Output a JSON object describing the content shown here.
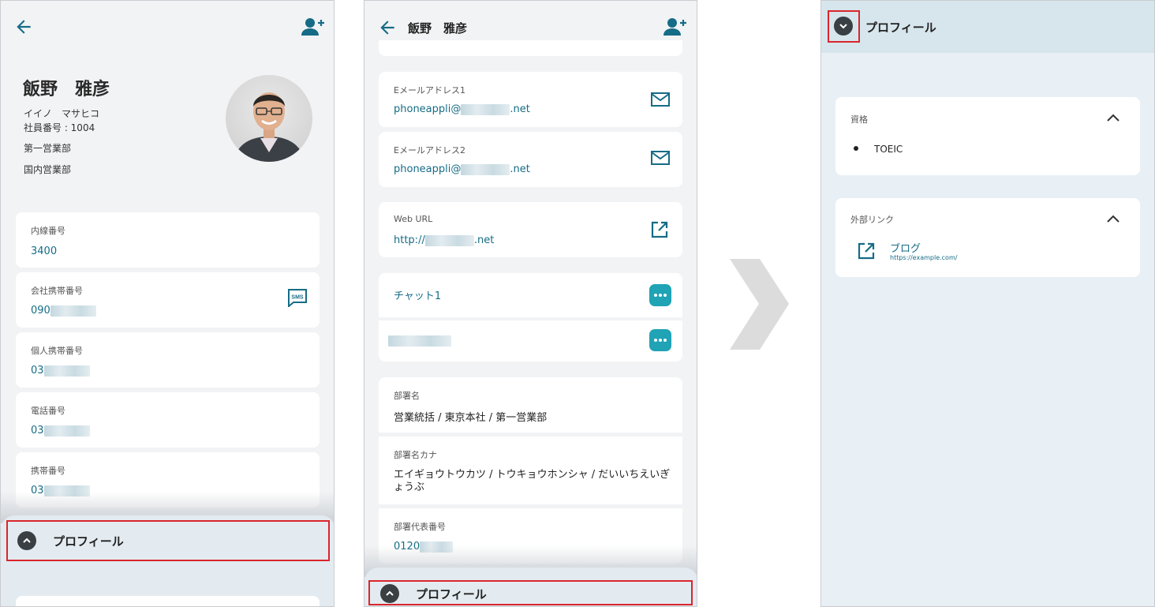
{
  "screen1": {
    "name": "飯野　雅彦",
    "kana": "イイノ　マサヒコ",
    "employee_no": "社員番号 : 1004",
    "dept1": "第一営業部",
    "dept2": "国内営業部",
    "fields": [
      {
        "label": "内線番号",
        "value": "3400"
      },
      {
        "label": "会社携帯番号",
        "value": "090",
        "icon": "sms-icon"
      },
      {
        "label": "個人携帯番号",
        "value": "03"
      },
      {
        "label": "電話番号",
        "value": "03"
      },
      {
        "label": "携帯番号",
        "value": "03"
      }
    ],
    "profile_label": "プロフィール"
  },
  "screen2": {
    "header_name": "飯野　雅彦",
    "email1": {
      "label": "Eメールアドレス1",
      "prefix": "phoneappli@",
      "suffix": ".net"
    },
    "email2": {
      "label": "Eメールアドレス2",
      "prefix": "phoneappli@",
      "suffix": ".net"
    },
    "web": {
      "label": "Web URL",
      "prefix": "http://",
      "suffix": ".net"
    },
    "chat1": {
      "label": "チャット1"
    },
    "dept_name": {
      "label": "部署名",
      "value": "営業統括 / 東京本社 / 第一営業部"
    },
    "dept_kana": {
      "label": "部署名カナ",
      "value": "エイギョウトウカツ / トウキョウホンシャ / だいいちえいぎ\nょうぶ"
    },
    "dept_phone": {
      "label": "部署代表番号",
      "value": "0120"
    },
    "profile_label": "プロフィール"
  },
  "screen3": {
    "profile_label": "プロフィール",
    "qualification": {
      "label": "資格",
      "items": [
        "TOEIC"
      ]
    },
    "external_links": {
      "label": "外部リンク",
      "link_title": "ブログ",
      "link_url": "https://example.com/"
    }
  },
  "colors": {
    "accent": "#166c86",
    "highlight": "#d9262c",
    "chat": "#1fa3b5"
  }
}
